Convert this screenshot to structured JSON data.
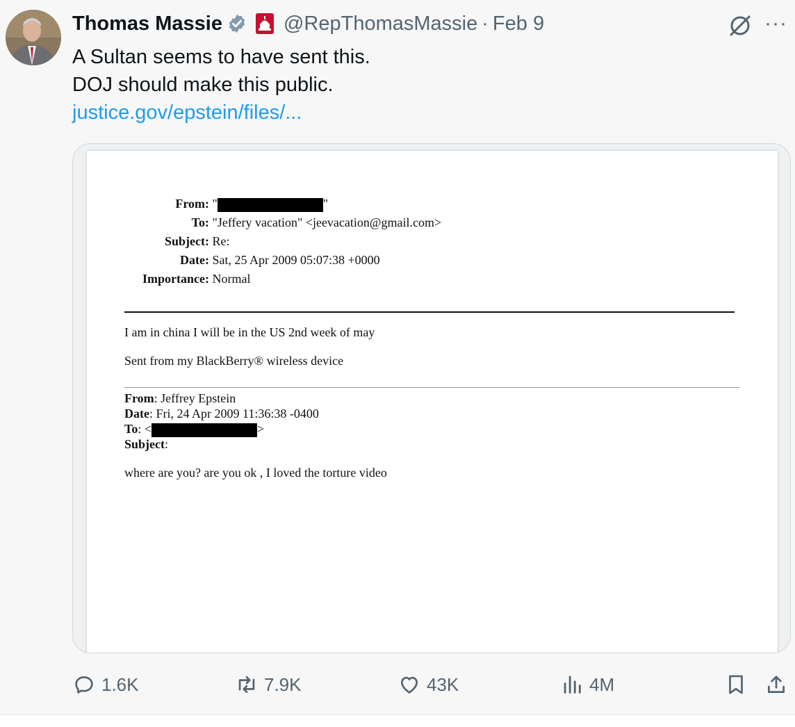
{
  "tweet": {
    "author_name": "Thomas Massie",
    "handle": "@RepThomasMassie",
    "separator": "·",
    "date": "Feb 9",
    "more_label": "···",
    "text_lines": [
      "A Sultan seems to have sent this.",
      "DOJ should make this public."
    ],
    "link_text": "justice.gov/epstein/files/..."
  },
  "document": {
    "header": {
      "from_label": "From:",
      "from_value_prefix": "\"",
      "from_value_suffix": "\"",
      "to_label": "To:",
      "to_value": "\"Jeffery vacation\" <jeevacation@gmail.com>",
      "subject_label": "Subject:",
      "subject_value": "Re:",
      "date_label": "Date:",
      "date_value": "Sat, 25 Apr 2009 05:07:38 +0000",
      "importance_label": "Importance:",
      "importance_value": "Normal"
    },
    "body": {
      "line1": "I am in china I will be in the US 2nd week of may",
      "line2": "Sent from my BlackBerry® wireless device"
    },
    "forwarded": {
      "from_label": "From",
      "from_value": ": Jeffrey Epstein",
      "date_label": "Date",
      "date_value": ": Fri, 24 Apr 2009 11:36:38 -0400",
      "to_label": "To",
      "to_value_prefix": ": <",
      "to_value_suffix": ">",
      "subject_label": "Subject",
      "subject_value": ":",
      "body": "where are you? are you ok , I loved the torture video"
    }
  },
  "actions": {
    "replies": "1.6K",
    "reposts": "7.9K",
    "likes": "43K",
    "views": "4M"
  },
  "colors": {
    "link": "#1d9bf0",
    "verified": "#829aab",
    "affiliation": "#c8102e",
    "muted": "#536471"
  },
  "icons": [
    "verified-badge-icon",
    "capitol-affiliation-icon",
    "grok-icon",
    "more-icon",
    "reply-icon",
    "repost-icon",
    "like-icon",
    "views-icon",
    "bookmark-icon",
    "share-icon"
  ]
}
